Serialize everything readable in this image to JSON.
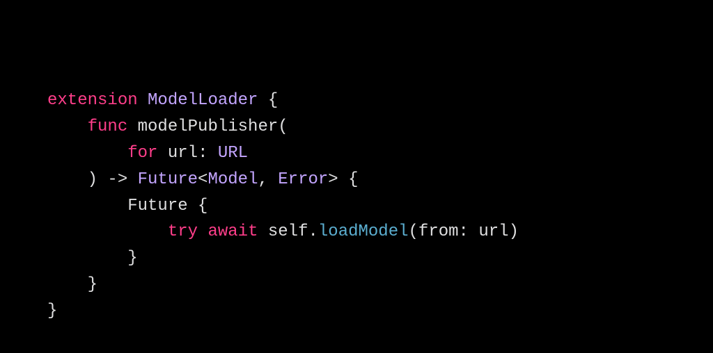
{
  "code": {
    "kw_extension": "extension",
    "type_ModelLoader": "ModelLoader",
    "brace_open_1": " {",
    "indent1": "    ",
    "kw_func": "func",
    "fn_modelPublisher": "modelPublisher",
    "paren_open_1": "(",
    "indent2": "        ",
    "kw_for": "for",
    "param_url": "url",
    "colon_space": ": ",
    "type_URL": "URL",
    "paren_close_1": ")",
    "arrow": " -> ",
    "type_Future": "Future",
    "lt": "<",
    "type_Model": "Model",
    "comma_space": ", ",
    "type_Error": "Error",
    "gt": ">",
    "brace_open_2": " {",
    "ref_Future": "Future",
    "brace_open_3": " {",
    "indent3": "            ",
    "kw_try": "try",
    "kw_await": "await",
    "ref_self": "self",
    "dot": ".",
    "call_loadModel": "loadModel",
    "paren_open_2": "(",
    "arg_from": "from",
    "ref_url": "url",
    "paren_close_2": ")",
    "brace_close_3": "}",
    "brace_close_2": "}",
    "brace_close_1": "}",
    "space": " "
  }
}
